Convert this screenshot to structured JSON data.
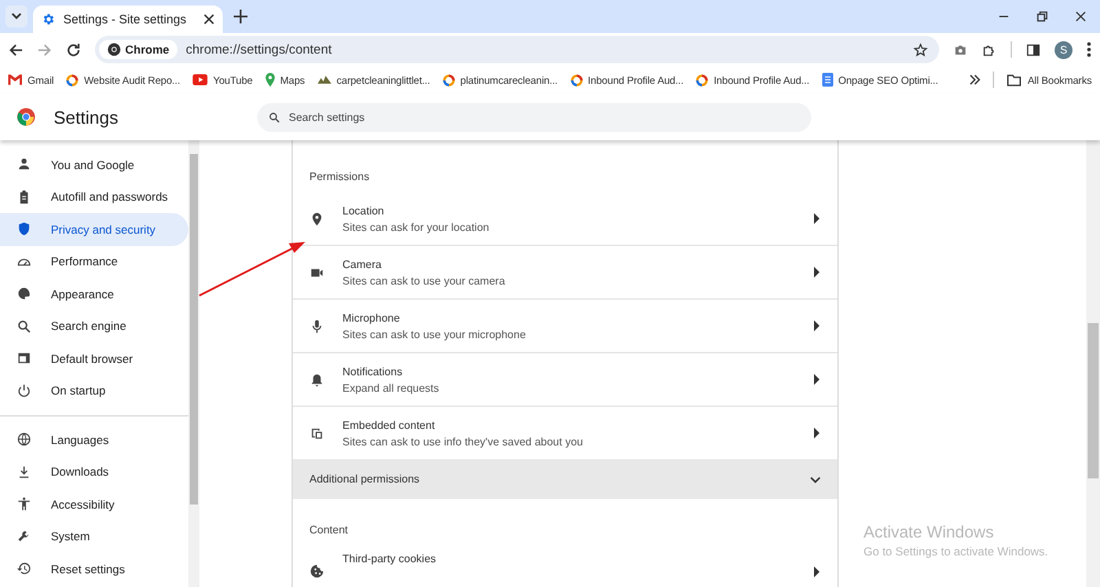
{
  "tabs": [
    {
      "title": "Settings - Site settings",
      "selected": true
    }
  ],
  "address_bar": {
    "chip": "Chrome",
    "url": "chrome://settings/content"
  },
  "profile_initial": "S",
  "bookmarks": [
    {
      "label": "Gmail",
      "kind": "gmail"
    },
    {
      "label": "Website Audit Repo...",
      "kind": "ring"
    },
    {
      "label": "YouTube",
      "kind": "youtube"
    },
    {
      "label": "Maps",
      "kind": "maps"
    },
    {
      "label": "carpetcleaninglittlet...",
      "kind": "site"
    },
    {
      "label": "platinumcarecleanin...",
      "kind": "ring"
    },
    {
      "label": "Inbound Profile Aud...",
      "kind": "ring"
    },
    {
      "label": "Inbound Profile Aud...",
      "kind": "ring"
    },
    {
      "label": "Onpage SEO Optimi...",
      "kind": "doc"
    }
  ],
  "all_bookmarks": "All Bookmarks",
  "header": {
    "title": "Settings",
    "search_placeholder": "Search settings"
  },
  "sidebar": {
    "groups": [
      [
        {
          "label": "You and Google",
          "kind": "person",
          "selected": false
        },
        {
          "label": "Autofill and passwords",
          "kind": "clipboard",
          "selected": false
        },
        {
          "label": "Privacy and security",
          "kind": "shield",
          "selected": true
        },
        {
          "label": "Performance",
          "kind": "gauge",
          "selected": false
        },
        {
          "label": "Appearance",
          "kind": "palette",
          "selected": false
        },
        {
          "label": "Search engine",
          "kind": "search",
          "selected": false
        },
        {
          "label": "Default browser",
          "kind": "browser",
          "selected": false
        },
        {
          "label": "On startup",
          "kind": "power",
          "selected": false
        }
      ],
      [
        {
          "label": "Languages",
          "kind": "globe",
          "selected": false
        },
        {
          "label": "Downloads",
          "kind": "download",
          "selected": false
        },
        {
          "label": "Accessibility",
          "kind": "accessibility",
          "selected": false
        },
        {
          "label": "System",
          "kind": "wrench",
          "selected": false
        },
        {
          "label": "Reset settings",
          "kind": "history",
          "selected": false
        }
      ]
    ]
  },
  "permissions": {
    "heading": "Permissions",
    "rows": [
      {
        "title": "Location",
        "subtitle": "Sites can ask for your location",
        "kind": "pin"
      },
      {
        "title": "Camera",
        "subtitle": "Sites can ask to use your camera",
        "kind": "camera"
      },
      {
        "title": "Microphone",
        "subtitle": "Sites can ask to use your microphone",
        "kind": "mic"
      },
      {
        "title": "Notifications",
        "subtitle": "Expand all requests",
        "kind": "bell"
      },
      {
        "title": "Embedded content",
        "subtitle": "Sites can ask to use info they've saved about you",
        "kind": "embed"
      }
    ]
  },
  "additional_permissions": {
    "label": "Additional permissions",
    "expanded": false
  },
  "content": {
    "heading": "Content",
    "rows": [
      {
        "title": "Third-party cookies",
        "kind": "cookie"
      }
    ]
  },
  "windows_notice": {
    "title": "Activate Windows",
    "subtitle": "Go to Settings to activate Windows."
  }
}
